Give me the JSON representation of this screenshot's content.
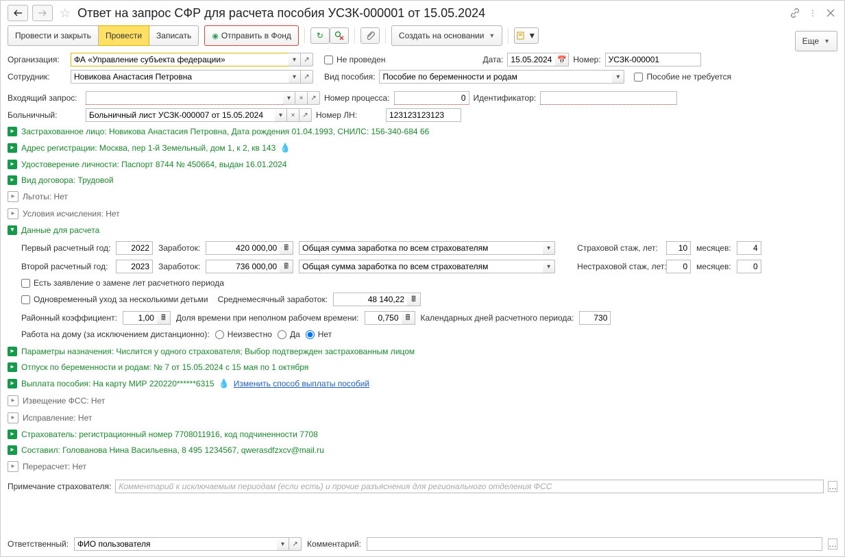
{
  "title": "Ответ на запрос СФР для расчета пособия УСЗК-000001 от 15.05.2024",
  "toolbar": {
    "post_close": "Провести и закрыть",
    "post": "Провести",
    "save": "Записать",
    "send_to_fund": "Отправить в Фонд",
    "create_on_basis": "Создать на основании",
    "more": "Еще"
  },
  "header": {
    "org_label": "Организация:",
    "org_value": "ФА «Управление субъекта федерации»",
    "not_posted": "Не проведен",
    "date_label": "Дата:",
    "date_value": "15.05.2024",
    "number_label": "Номер:",
    "number_value": "УСЗК-000001",
    "employee_label": "Сотрудник:",
    "employee_value": "Новикова Анастасия Петровна",
    "benefit_type_label": "Вид пособия:",
    "benefit_type_value": "Пособие по беременности и родам",
    "benefit_not_needed": "Пособие не требуется",
    "incoming_request_label": "Входящий запрос:",
    "incoming_request_value": "",
    "process_no_label": "Номер процесса:",
    "process_no_value": "0",
    "identifier_label": "Идентификатор:",
    "identifier_value": "",
    "sick_leave_label": "Больничный:",
    "sick_leave_value": "Больничный лист УСЗК-000007 от 15.05.2024",
    "ln_no_label": "Номер ЛН:",
    "ln_no_value": "123123123123"
  },
  "tree": {
    "insured": "Застрахованное лицо: Новикова Анастасия Петровна, Дата рождения 01.04.1993, СНИЛС: 156-340-684 66",
    "address": "Адрес регистрации: Москва, пер 1-й Земельный, дом 1, к 2, кв 143",
    "identity": "Удостоверение личности: Паспорт 8744 № 450664, выдан 16.01.2024",
    "contract": "Вид договора: Трудовой",
    "benefits": "Льготы: Нет",
    "calc_cond": "Условия исчисления: Нет",
    "calc_data": "Данные для расчета",
    "assign_params": "Параметры назначения: Числится у одного страхователя; Выбор подтвержден застрахованным лицом",
    "maternity_leave": "Отпуск по беременности и родам: № 7 от 15.05.2024 с 15 мая по 1 октября",
    "payment": "Выплата пособия: На карту МИР 220220******6315",
    "change_pay_method": "Изменить способ выплаты пособий",
    "fss_notice": "Извещение ФСС: Нет",
    "correction": "Исправление: Нет",
    "insurer": "Страхователь: регистрационный номер 7708011916, код подчиненности 7708",
    "author": "Составил: Голованова Нина Васильевна, 8 495 1234567, qwerasdfzxcv@mail.ru",
    "recalc": "Перерасчет: Нет"
  },
  "calc": {
    "year1_label": "Первый расчетный год:",
    "year1": "2022",
    "earnings_label": "Заработок:",
    "earnings1": "420 000,00",
    "earn_type": "Общая сумма заработка по всем страхователям",
    "ins_exp_label": "Страховой стаж, лет:",
    "ins_years": "10",
    "months_label": "месяцев:",
    "ins_months": "4",
    "year2_label": "Второй расчетный год:",
    "year2": "2023",
    "earnings2": "736 000,00",
    "nonins_exp_label": "Нестраховой стаж, лет:",
    "nonins_years": "0",
    "nonins_months": "0",
    "replace_years": "Есть заявление о замене лет расчетного периода",
    "multi_care": "Одновременный уход за несколькими детьми",
    "avg_monthly_label": "Среднемесячный заработок:",
    "avg_monthly": "48 140,22",
    "district_coef_label": "Районный коэффициент:",
    "district_coef": "1,00",
    "parttime_label": "Доля времени при неполном рабочем времени:",
    "parttime": "0,750",
    "calendar_days_label": "Календарных дней расчетного периода:",
    "calendar_days": "730",
    "homework_label": "Работа на дому (за исключением дистанционно):",
    "unknown": "Неизвестно",
    "yes": "Да",
    "no": "Нет"
  },
  "footer": {
    "insurer_note_label": "Примечание страхователя:",
    "insurer_note_ph": "Комментарий к исключаемым периодам (если есть) и прочие разъяснения для регионального отделения ФСС",
    "responsible_label": "Ответственный:",
    "responsible_value": "ФИО пользователя",
    "comment_label": "Комментарий:",
    "comment_value": ""
  }
}
